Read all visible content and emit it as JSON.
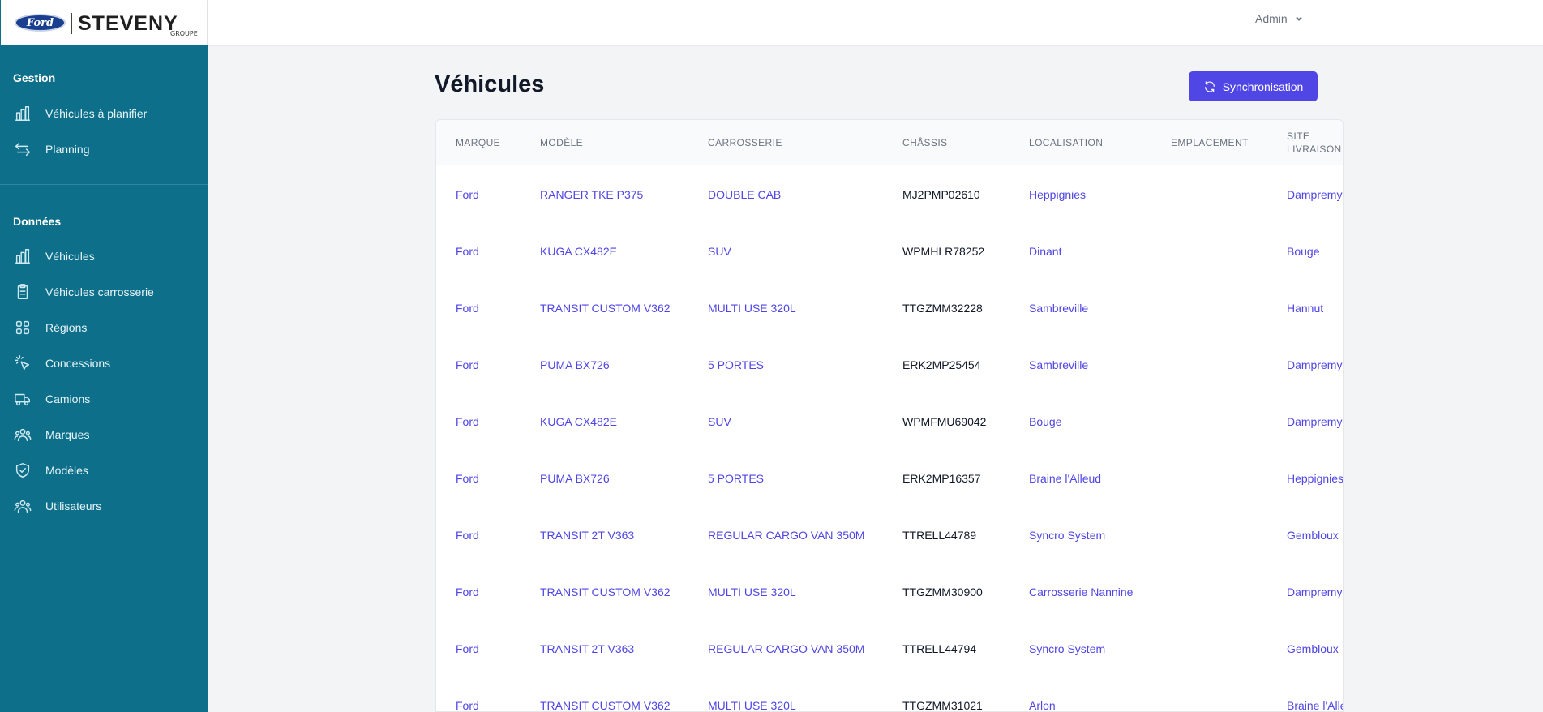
{
  "brand": {
    "ford": "Ford",
    "name": "STEVENY",
    "sub": "GROUPE"
  },
  "user": {
    "name": "Admin"
  },
  "sidebar": {
    "sections": [
      {
        "title": "Gestion",
        "items": [
          {
            "label": "Véhicules à planifier",
            "icon": "bar-chart-icon"
          },
          {
            "label": "Planning",
            "icon": "arrows-swap-icon"
          }
        ]
      },
      {
        "title": "Données",
        "items": [
          {
            "label": "Véhicules",
            "icon": "bar-chart-icon"
          },
          {
            "label": "Véhicules carrosserie",
            "icon": "clipboard-icon"
          },
          {
            "label": "Régions",
            "icon": "grid-icon"
          },
          {
            "label": "Concessions",
            "icon": "cursor-click-icon"
          },
          {
            "label": "Camions",
            "icon": "truck-icon"
          },
          {
            "label": "Marques",
            "icon": "users-icon"
          },
          {
            "label": "Modèles",
            "icon": "shield-check-icon"
          },
          {
            "label": "Utilisateurs",
            "icon": "users-icon"
          }
        ]
      }
    ]
  },
  "main": {
    "title": "Véhicules",
    "sync_label": "Synchronisation",
    "columns": [
      "Marque",
      "Modèle",
      "Carrosserie",
      "Châssis",
      "Localisation",
      "Emplacement",
      "Site livraison"
    ],
    "rows": [
      {
        "marque": "Ford",
        "modele": "RANGER TKE P375",
        "carrosserie": "DOUBLE CAB",
        "chassis": "MJ2PMP02610",
        "localisation": "Heppignies",
        "emplacement": "",
        "site": "Dampremy"
      },
      {
        "marque": "Ford",
        "modele": "KUGA CX482E",
        "carrosserie": "SUV",
        "chassis": "WPMHLR78252",
        "localisation": "Dinant",
        "emplacement": "",
        "site": "Bouge"
      },
      {
        "marque": "Ford",
        "modele": "TRANSIT CUSTOM V362",
        "carrosserie": "MULTI USE 320L",
        "chassis": "TTGZMM32228",
        "localisation": "Sambreville",
        "emplacement": "",
        "site": "Hannut"
      },
      {
        "marque": "Ford",
        "modele": "PUMA BX726",
        "carrosserie": "5 PORTES",
        "chassis": "ERK2MP25454",
        "localisation": "Sambreville",
        "emplacement": "",
        "site": "Dampremy"
      },
      {
        "marque": "Ford",
        "modele": "KUGA CX482E",
        "carrosserie": "SUV",
        "chassis": "WPMFMU69042",
        "localisation": "Bouge",
        "emplacement": "",
        "site": "Dampremy"
      },
      {
        "marque": "Ford",
        "modele": "PUMA BX726",
        "carrosserie": "5 PORTES",
        "chassis": "ERK2MP16357",
        "localisation": "Braine l'Alleud",
        "emplacement": "",
        "site": "Heppignies"
      },
      {
        "marque": "Ford",
        "modele": "TRANSIT 2T V363",
        "carrosserie": "REGULAR CARGO VAN 350M",
        "chassis": "TTRELL44789",
        "localisation": "Syncro System",
        "emplacement": "",
        "site": "Gembloux"
      },
      {
        "marque": "Ford",
        "modele": "TRANSIT CUSTOM V362",
        "carrosserie": "MULTI USE 320L",
        "chassis": "TTGZMM30900",
        "localisation": "Carrosserie Nannine",
        "emplacement": "",
        "site": "Dampremy"
      },
      {
        "marque": "Ford",
        "modele": "TRANSIT 2T V363",
        "carrosserie": "REGULAR CARGO VAN 350M",
        "chassis": "TTRELL44794",
        "localisation": "Syncro System",
        "emplacement": "",
        "site": "Gembloux"
      },
      {
        "marque": "Ford",
        "modele": "TRANSIT CUSTOM V362",
        "carrosserie": "MULTI USE 320L",
        "chassis": "TTGZMM31021",
        "localisation": "Arlon",
        "emplacement": "",
        "site": "Braine l'Alleud"
      }
    ]
  },
  "colors": {
    "sidebar": "#0e6f8a",
    "accent": "#4f46e5",
    "background": "#f3f4f6"
  }
}
